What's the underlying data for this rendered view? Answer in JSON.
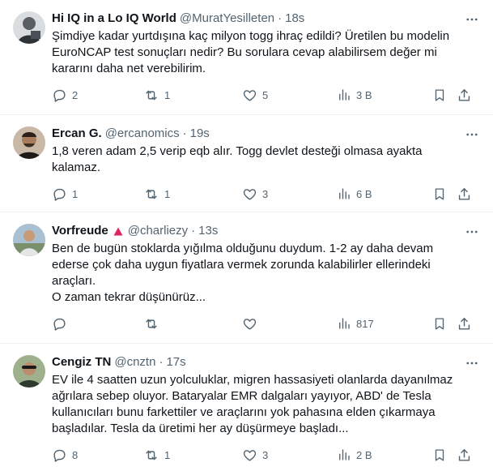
{
  "tweets": [
    {
      "name": "Hi IQ in a Lo IQ World",
      "handle": "@MuratYesilleten",
      "time": "18s",
      "text": "Şimdiye kadar yurtdışına kaç milyon togg ihraç edildi? Üretilen bu modelin\nEuroNCAP test sonuçları nedir? Bu sorulara cevap alabilirsem değer mi\nkararını daha net verebilirim.",
      "replies": "2",
      "retweets": "1",
      "likes": "5",
      "views": "3 B",
      "avatar_color": "#5a5f66"
    },
    {
      "name": "Ercan G.",
      "handle": "@ercanomics",
      "time": "19s",
      "text": "1,8 veren adam 2,5 verip eqb alır. Togg devlet desteği olmasa ayakta\nkalamaz.",
      "replies": "1",
      "retweets": "1",
      "likes": "3",
      "views": "6 B",
      "avatar_color": "#3b2e24"
    },
    {
      "name": "Vorfreude",
      "handle": "@charliezy",
      "time": "13s",
      "text": "Ben de bugün stoklarda yığılma olduğunu duydum. 1-2 ay daha devam\nederse çok daha uygun fiyatlara vermek zorunda kalabilirler ellerindeki\naraçları.\nO zaman tekrar düşünürüz...",
      "replies": "",
      "retweets": "",
      "likes": "",
      "views": "817",
      "avatar_color": "#8fa6b8",
      "badge_color": "#e0245e"
    },
    {
      "name": "Cengiz TN",
      "handle": "@cnztn",
      "time": "17s",
      "text": "EV ile 4 saatten uzun yolculuklar, migren hassasiyeti olanlarda dayanılmaz\nağrılara sebep oluyor. Bataryalar EMR dalgaları yayıyor, ABD' de Tesla\nkullanıcıları bunu farkettiler ve araçlarını yok pahasına elden çıkarmaya\nbaşladılar. Tesla da üretimi her ay düşürmeye başladı...",
      "replies": "8",
      "retweets": "1",
      "likes": "3",
      "views": "2 B",
      "avatar_color": "#6b7f6a"
    }
  ],
  "separator": "·"
}
